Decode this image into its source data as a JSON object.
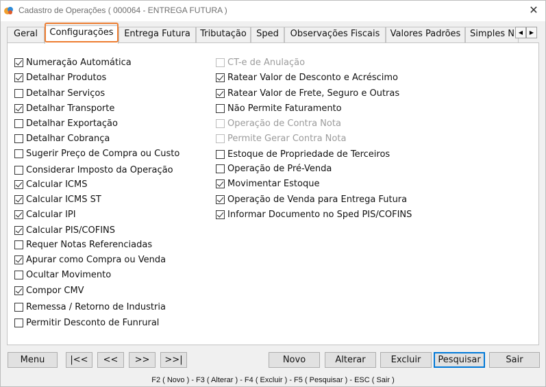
{
  "window": {
    "title": "Cadastro de Operações ( 000064 - ENTREGA FUTURA )",
    "close_label": "✕"
  },
  "tabs": [
    {
      "label": "Geral",
      "active": false
    },
    {
      "label": "Configurações",
      "active": true
    },
    {
      "label": "Entrega Futura",
      "active": false
    },
    {
      "label": "Tributação",
      "active": false
    },
    {
      "label": "Sped",
      "active": false
    },
    {
      "label": "Observações Fiscais",
      "active": false
    },
    {
      "label": "Valores Padrões",
      "active": false
    },
    {
      "label": "Simples N",
      "active": false
    }
  ],
  "tab_scroll": {
    "left": "◀",
    "right": "▶"
  },
  "highlight_color": "#ed7d31",
  "options_left": [
    {
      "label": "Numeração Automática",
      "checked": true,
      "enabled": true
    },
    {
      "label": "Detalhar Produtos",
      "checked": true,
      "enabled": true
    },
    {
      "label": "Detalhar Serviços",
      "checked": false,
      "enabled": true
    },
    {
      "label": "Detalhar Transporte",
      "checked": true,
      "enabled": true
    },
    {
      "label": "Detalhar Exportação",
      "checked": false,
      "enabled": true
    },
    {
      "label": "Detalhar Cobrança",
      "checked": false,
      "enabled": true
    },
    {
      "label": "Sugerir Preço de Compra ou Custo",
      "checked": false,
      "enabled": true
    },
    {
      "label": "Considerar Imposto da Operação",
      "checked": false,
      "enabled": true
    },
    {
      "label": "Calcular ICMS",
      "checked": true,
      "enabled": true
    },
    {
      "label": "Calcular ICMS ST",
      "checked": true,
      "enabled": true
    },
    {
      "label": "Calcular IPI",
      "checked": true,
      "enabled": true
    },
    {
      "label": "Calcular PIS/COFINS",
      "checked": true,
      "enabled": true
    },
    {
      "label": "Requer Notas Referenciadas",
      "checked": false,
      "enabled": true
    },
    {
      "label": "Apurar como Compra ou Venda",
      "checked": true,
      "enabled": true
    },
    {
      "label": "Ocultar Movimento",
      "checked": false,
      "enabled": true
    },
    {
      "label": "Compor CMV",
      "checked": true,
      "enabled": true
    },
    {
      "label": "Remessa / Retorno de Industria",
      "checked": false,
      "enabled": true
    },
    {
      "label": "Permitir Desconto de Funrural",
      "checked": false,
      "enabled": true
    }
  ],
  "options_right": [
    {
      "label": "CT-e de Anulação",
      "checked": false,
      "enabled": false
    },
    {
      "label": "Ratear Valor de Desconto e Acréscimo",
      "checked": true,
      "enabled": true
    },
    {
      "label": "Ratear Valor de Frete, Seguro e Outras",
      "checked": true,
      "enabled": true
    },
    {
      "label": "Não Permite Faturamento",
      "checked": false,
      "enabled": true
    },
    {
      "label": "Operação de Contra Nota",
      "checked": false,
      "enabled": false
    },
    {
      "label": "Permite Gerar Contra Nota",
      "checked": false,
      "enabled": false
    },
    {
      "label": "Estoque de Propriedade de Terceiros",
      "checked": false,
      "enabled": true
    },
    {
      "label": "Operação de Pré-Venda",
      "checked": false,
      "enabled": true
    },
    {
      "label": "Movimentar Estoque",
      "checked": true,
      "enabled": true
    },
    {
      "label": "Operação de Venda para Entrega Futura",
      "checked": true,
      "enabled": true
    },
    {
      "label": "Informar Documento no Sped PIS/COFINS",
      "checked": true,
      "enabled": true
    }
  ],
  "buttons": {
    "menu": "Menu",
    "first": "|<<",
    "prev": "<<",
    "next": ">>",
    "last": ">>|",
    "novo": "Novo",
    "alterar": "Alterar",
    "excluir": "Excluir",
    "pesquisar": "Pesquisar",
    "sair": "Sair"
  },
  "status_bar": "F2 ( Novo )  -  F3 ( Alterar )  -  F4 ( Excluir )  -  F5 ( Pesquisar )  -  ESC ( Sair )"
}
